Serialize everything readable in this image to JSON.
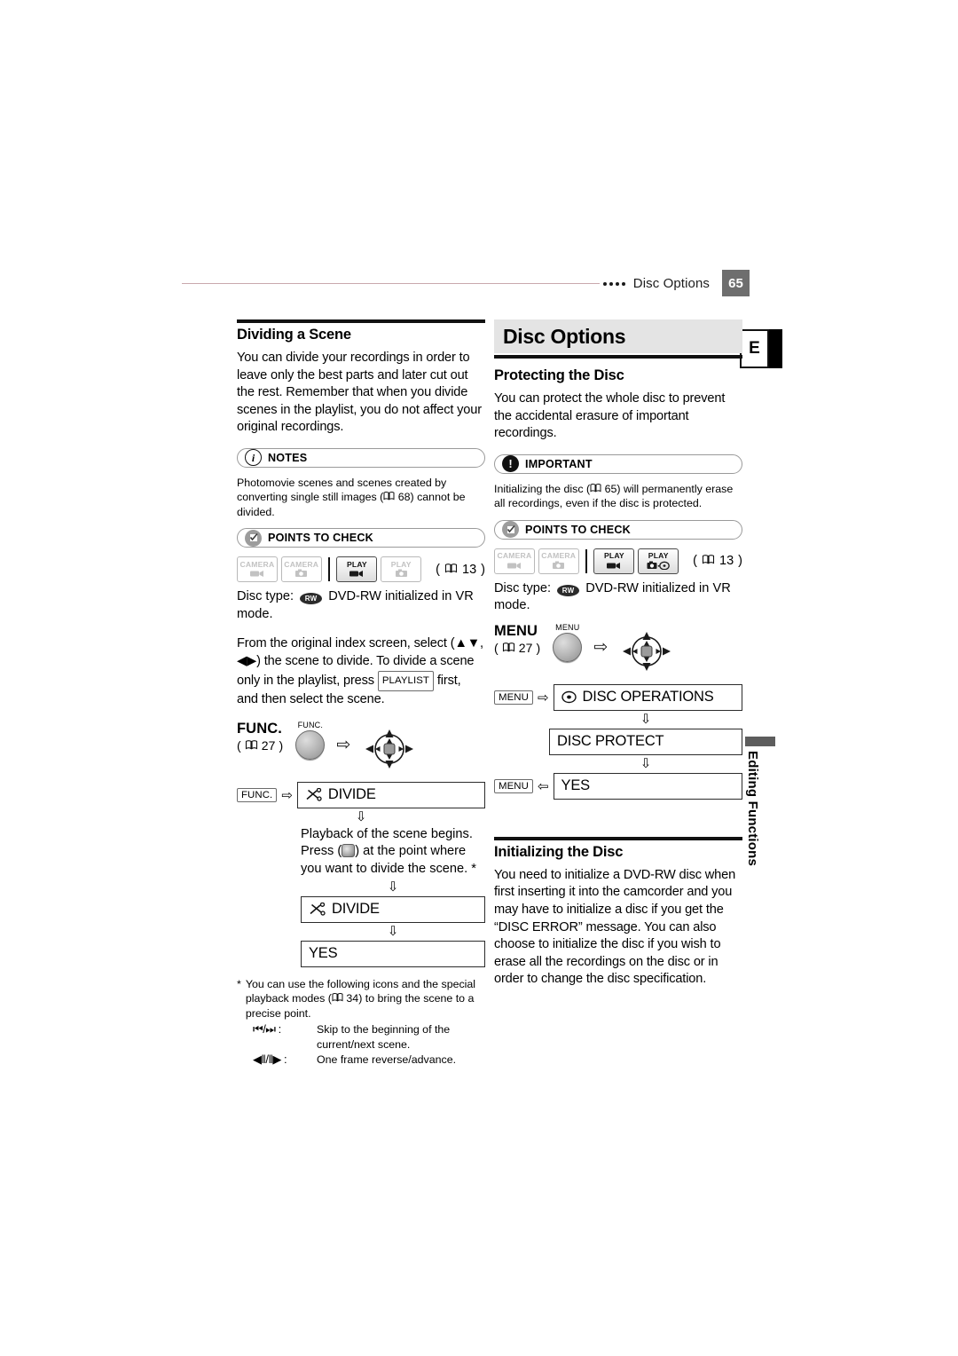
{
  "header": {
    "chapter_title": "Disc Options",
    "page_number": "65",
    "dots_count": 4
  },
  "side_tab": {
    "letter": "E",
    "vertical_label": "Editing Functions"
  },
  "left_column": {
    "heading": "Dividing a Scene",
    "intro": "You can divide your recordings in order to leave only the best parts and later cut out the rest. Remember that when you divide scenes in the playlist, you do not affect your original recordings.",
    "notes": {
      "label": "NOTES",
      "icon": "info-icon",
      "text": "Photomovie scenes and scenes created by converting single still images (  68) cannot be divided.",
      "text_before_ref": "Photomovie scenes and scenes created by converting single still images (",
      "ref_page": "68",
      "text_after_ref": ") cannot be divided."
    },
    "points_to_check": {
      "label": "POINTS TO CHECK",
      "icon": "check-circle-icon",
      "modes": [
        {
          "name": "CAMERA",
          "sub": "movie",
          "active": false
        },
        {
          "name": "CAMERA",
          "sub": "photo",
          "active": false
        },
        {
          "name": "PLAY",
          "sub": "movie",
          "active": true
        },
        {
          "name": "PLAY",
          "sub": "photo",
          "active": false
        }
      ],
      "page_ref": "13",
      "disc_type_label": "Disc type:",
      "disc_type_badge": "RW",
      "disc_type_value": "DVD-RW initialized in VR mode."
    },
    "instruction": {
      "part1": "From the original index screen, select (",
      "joy_updown": "▲▼",
      "part2": ", ",
      "joy_leftright": "◀▶",
      "part3": ") the scene to divide. To divide a scene only in the playlist, press ",
      "playlist_key": "PLAYLIST",
      "part4": " first, and then select the scene."
    },
    "control": {
      "label": "FUNC.",
      "page_ref": "27",
      "button_cap": "FUNC.",
      "arrow": "⇨"
    },
    "flow": {
      "step1_key": "FUNC.",
      "step1_arrow": "⇨",
      "step1_icon": "divide-scissors-icon",
      "step1_label": "DIVIDE",
      "down_arrow": "⇩",
      "step2_text_a": "Playback of the scene begins. Press (",
      "step2_joystick_icon": "joystick-press-icon",
      "step2_text_b": ") at the point where you want to divide the scene. *",
      "step3_icon": "divide-scissors-icon",
      "step3_label": "DIVIDE",
      "step4_label": "YES"
    },
    "footnote": {
      "marker": "*",
      "text_a": "You can use the following icons and the special playback modes (",
      "ref_page": "34",
      "text_b": ") to bring the scene to a precise point.",
      "rows": [
        {
          "icons": "⏮/⏭ :",
          "desc": "Skip to the beginning of the current/next scene."
        },
        {
          "icons": "◀‖/‖▶ :",
          "desc": "One frame reverse/advance."
        }
      ]
    }
  },
  "right_column": {
    "banner_title": "Disc Options",
    "protecting": {
      "heading": "Protecting the Disc",
      "intro": "You can protect the whole disc to prevent the accidental erasure of important recordings.",
      "important": {
        "label": "IMPORTANT",
        "icon": "exclamation-icon",
        "text_before_ref": "Initializing the disc (",
        "ref_page": "65",
        "text_after_ref": ") will permanently erase all recordings, even if the disc is protected."
      },
      "points_to_check": {
        "label": "POINTS TO CHECK",
        "icon": "check-circle-icon",
        "modes": [
          {
            "name": "CAMERA",
            "sub": "movie",
            "active": false
          },
          {
            "name": "CAMERA",
            "sub": "photo",
            "active": false
          },
          {
            "name": "PLAY",
            "sub": "movie",
            "active": true
          },
          {
            "name": "PLAY",
            "sub": "photo-disc",
            "active": true
          }
        ],
        "page_ref": "13",
        "disc_type_label": "Disc type:",
        "disc_type_badge": "RW",
        "disc_type_value": "DVD-RW initialized in VR mode."
      },
      "control": {
        "label": "MENU",
        "page_ref": "27",
        "button_cap": "MENU",
        "arrow": "⇨"
      },
      "flow": {
        "step1_key": "MENU",
        "step1_arrow": "⇨",
        "step1_icon": "disc-icon",
        "step1_label": "DISC OPERATIONS",
        "down_arrow": "⇩",
        "step2_label": "DISC PROTECT",
        "step3_key": "MENU",
        "step3_arrow": "⇦",
        "step3_label": "YES"
      }
    },
    "initializing": {
      "heading": "Initializing the Disc",
      "text": "You need to initialize a DVD-RW disc when first inserting it into the camcorder and you may have to initialize a disc if you get the “DISC ERROR” message. You can also choose to initialize the disc if you wish to erase all the recordings on the disc or in order to change the disc specification."
    }
  },
  "colors": {
    "rule": "#c9a9ad",
    "page_badge_bg": "#6e6e6e",
    "banner_bg": "#e4e4e4",
    "side_bar": "#5d5d5d"
  }
}
